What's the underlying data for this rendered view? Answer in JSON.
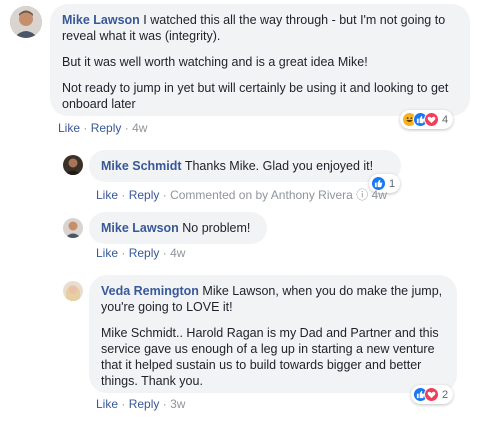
{
  "comments": [
    {
      "author": "Mike Lawson",
      "paragraphs": [
        "I watched this all the way through - but I'm not going to reveal what it was (integrity).",
        "But it was well worth watching and is a great idea Mike!",
        "Not ready to jump in yet but will certainly be using it and looking to get onboard later"
      ],
      "like": "Like",
      "reply": "Reply",
      "time": "4w",
      "reaction_count": "4"
    },
    {
      "author": "Mike Schmidt",
      "text": "Thanks Mike. Glad you enjoyed it!",
      "like": "Like",
      "reply": "Reply",
      "commented_on": "Commented on by Anthony Rivera",
      "time": "4w",
      "reaction_count": "1"
    },
    {
      "author": "Mike Lawson",
      "text": "No problem!",
      "like": "Like",
      "reply": "Reply",
      "time": "4w"
    },
    {
      "author": "Veda Remington",
      "text": "Mike Lawson, when you do make the jump, you're going to LOVE it!",
      "paragraph2": "Mike Schmidt.. Harold Ragan is my Dad and Partner and this service gave us enough of a leg up in starting a new venture that it helped sustain us to build towards bigger and better things. Thank you.",
      "like": "Like",
      "reply": "Reply",
      "time": "3w",
      "reaction_count": "2"
    }
  ],
  "separator": "·",
  "colors": {
    "link": "#385898",
    "bubble": "#f2f3f5",
    "like_blue": "#1877f2",
    "love_red": "#f33e58",
    "haha_yellow": "#f7b125"
  }
}
